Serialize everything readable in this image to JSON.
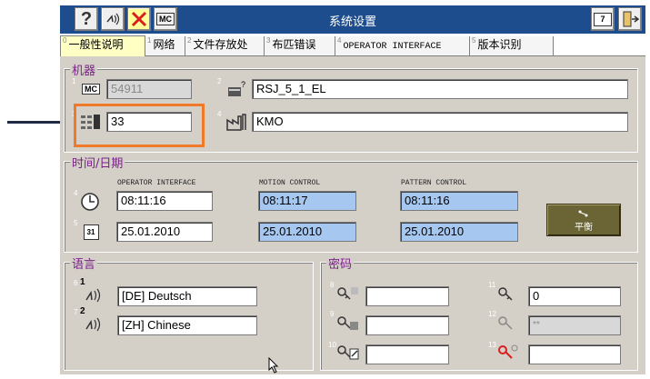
{
  "window": {
    "title": "系统设置"
  },
  "toolbar": {
    "help_icon": "question-icon",
    "machine_icon_label": "MC",
    "book_number": "7",
    "exit_icon": "exit-icon"
  },
  "tabs": [
    {
      "num": "0",
      "label": "一般性说明",
      "active": true
    },
    {
      "num": "1",
      "label": "网络"
    },
    {
      "num": "2",
      "label": "文件存放处"
    },
    {
      "num": "3",
      "label": "布匹错误"
    },
    {
      "num": "4",
      "label": "OPERATOR INTERFACE"
    },
    {
      "num": "5",
      "label": "版本识别"
    }
  ],
  "machine": {
    "title": "机器",
    "mc_label": "MC",
    "mc_value": "54911",
    "model_value": "RSJ_5_1_EL",
    "count_value": "33",
    "factory_value": "KMO",
    "sup": [
      "1",
      "2",
      "3",
      "4"
    ]
  },
  "datetime": {
    "title": "时间/日期",
    "headers": [
      "OPERATOR INTERFACE",
      "MOTION CONTROL",
      "PATTERN CONTROL"
    ],
    "time_values": [
      "08:11:16",
      "08:11:17",
      "08:11:16"
    ],
    "date_values": [
      "25.01.2010",
      "25.01.2010",
      "25.01.2010"
    ],
    "calendar_label": "31",
    "sup": [
      "4",
      "5"
    ],
    "balance_button": "平衡"
  },
  "language": {
    "title": "语言",
    "items": [
      {
        "sup": "6",
        "num": "1",
        "value": "[DE] Deutsch"
      },
      {
        "sup": "7",
        "num": "2",
        "value": "[ZH] Chinese"
      }
    ]
  },
  "password": {
    "title": "密码",
    "items": [
      {
        "sup": "8",
        "value": ""
      },
      {
        "sup": "9",
        "value": ""
      },
      {
        "sup": "10",
        "value": ""
      },
      {
        "sup": "11",
        "value": "0"
      },
      {
        "sup": "12",
        "value": "**"
      },
      {
        "sup": "13",
        "value": ""
      }
    ]
  }
}
